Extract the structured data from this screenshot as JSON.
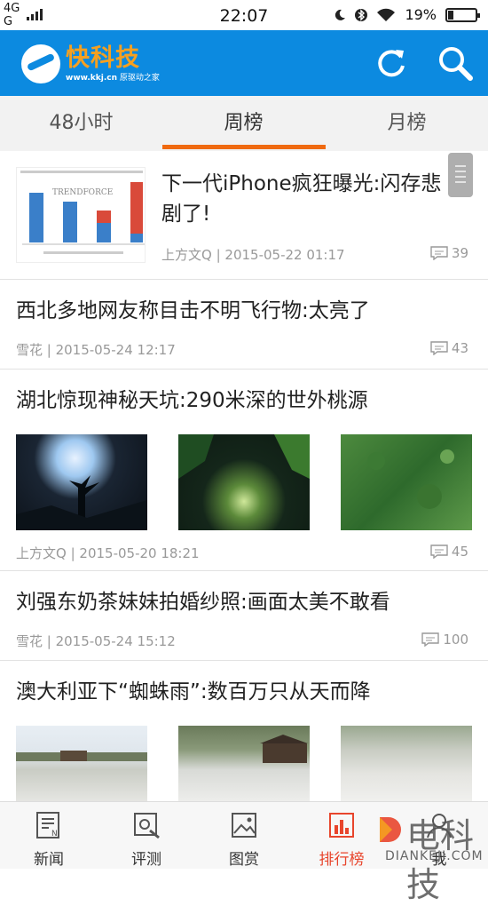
{
  "status_bar": {
    "network_top": "4G",
    "network_bottom": "G",
    "time": "22:07",
    "battery_percent": "19%",
    "battery_level": 0.19
  },
  "header": {
    "logo_name": "快科技",
    "logo_url": "www.kkj.cn",
    "logo_slogan": "原驱动之家",
    "refresh_icon": "refresh-icon",
    "search_icon": "search-icon",
    "bg_color": "#0c8ae0",
    "accent_color": "#f5a020"
  },
  "tabs": [
    {
      "label": "48小时"
    },
    {
      "label": "周榜",
      "active": true
    },
    {
      "label": "月榜"
    }
  ],
  "tab_indicator_color": "#f06a10",
  "articles": [
    {
      "title": "下一代iPhone疯狂曝光:闪存悲剧了!",
      "author_time": "上方文Q | 2015-05-22 01:17",
      "comments": "39",
      "thumb_brand": "TRENDFORCE"
    },
    {
      "title": "西北多地网友称目击不明飞行物:太亮了",
      "author_time": "雪花 | 2015-05-24 12:17",
      "comments": "43"
    },
    {
      "title": "湖北惊现神秘天坑:290米深的世外桃源",
      "author_time": "上方文Q | 2015-05-20 18:21",
      "comments": "45"
    },
    {
      "title": "刘强东奶茶妹妹拍婚纱照:画面太美不敢看",
      "author_time": "雪花 | 2015-05-24 15:12",
      "comments": "100"
    },
    {
      "title": "澳大利亚下“蜘蛛雨”:数百万只从天而降"
    }
  ],
  "bottom_nav": [
    {
      "label": "新闻",
      "icon": "news-icon"
    },
    {
      "label": "评测",
      "icon": "review-icon"
    },
    {
      "label": "图赏",
      "icon": "gallery-icon"
    },
    {
      "label": "排行榜",
      "icon": "ranking-icon",
      "active": true
    },
    {
      "label": "我",
      "icon": "user-icon"
    }
  ],
  "watermark": {
    "brand": "电科技",
    "domain": "DIANKEJI.COM"
  }
}
